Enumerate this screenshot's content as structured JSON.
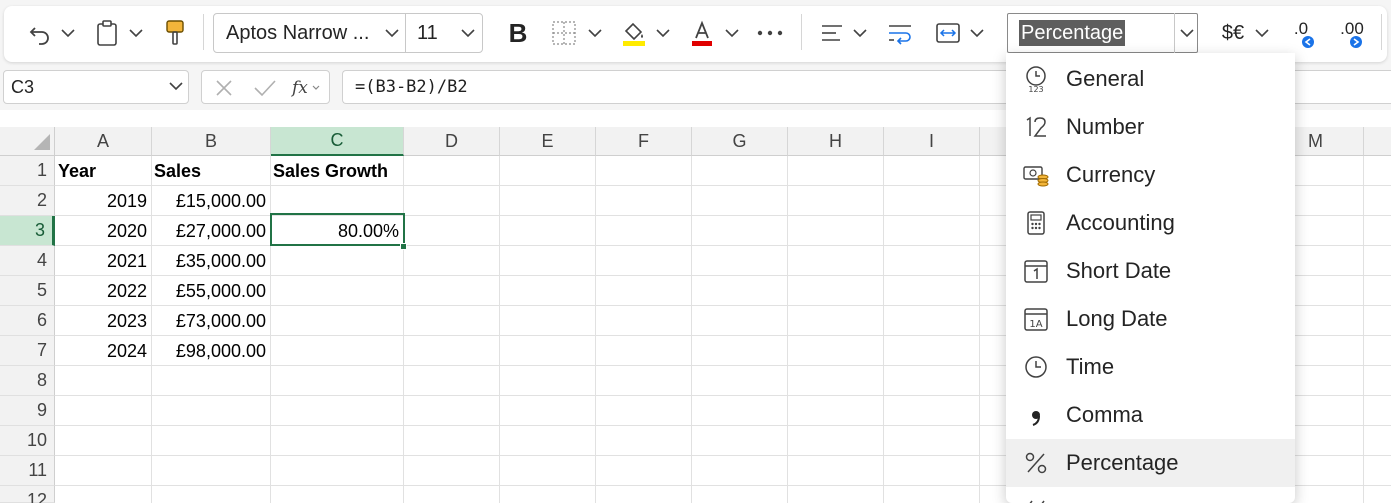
{
  "toolbar": {
    "font_name": "Aptos Narrow ...",
    "font_size": "11",
    "bold_label": "B",
    "number_format": "Percentage",
    "currency_label": "$€",
    "decrease_decimal_label": ".0",
    "increase_decimal_label": ".00"
  },
  "formula_bar": {
    "name_box": "C3",
    "fx_label": "fx",
    "formula": "=(B3-B2)/B2"
  },
  "grid": {
    "columns": [
      "A",
      "B",
      "C",
      "D",
      "E",
      "F",
      "G",
      "H",
      "I",
      "M"
    ],
    "selected_column": "C",
    "rows": [
      "1",
      "2",
      "3",
      "4",
      "5",
      "6",
      "7",
      "8",
      "9",
      "10",
      "11",
      "12"
    ],
    "selected_row": "3",
    "cells": {
      "A1": "Year",
      "B1": "Sales",
      "C1": "Sales Growth",
      "A2": "2019",
      "B2": "£15,000.00",
      "A3": "2020",
      "B3": "£27,000.00",
      "C3": "80.00%",
      "A4": "2021",
      "B4": "£35,000.00",
      "A5": "2022",
      "B5": "£55,000.00",
      "A6": "2023",
      "B6": "£73,000.00",
      "A7": "2024",
      "B7": "£98,000.00"
    },
    "active_cell": "C3"
  },
  "format_menu": {
    "items": [
      {
        "label": "General",
        "icon": "general-icon"
      },
      {
        "label": "Number",
        "icon": "number-icon"
      },
      {
        "label": "Currency",
        "icon": "currency-icon"
      },
      {
        "label": "Accounting",
        "icon": "accounting-icon"
      },
      {
        "label": "Short Date",
        "icon": "short-date-icon"
      },
      {
        "label": "Long Date",
        "icon": "long-date-icon"
      },
      {
        "label": "Time",
        "icon": "clock-icon"
      },
      {
        "label": "Comma",
        "icon": "comma-icon"
      },
      {
        "label": "Percentage",
        "icon": "percent-icon"
      }
    ],
    "highlighted": "Percentage"
  },
  "colors": {
    "accent_green": "#217346",
    "selection_fill": "#c8e6d2",
    "fill_color_swatch": "#ffeb00",
    "font_color_swatch": "#e00000",
    "decimal_arrow_blue": "#1a73e8"
  }
}
